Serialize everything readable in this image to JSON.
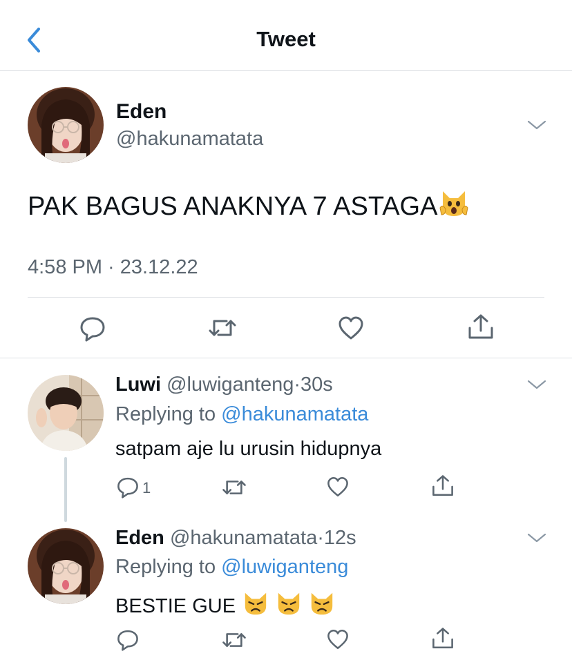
{
  "header": {
    "title": "Tweet",
    "back_icon": "chevron-left-icon"
  },
  "main_tweet": {
    "name": "Eden",
    "handle": "@hakunamatata",
    "text": "PAK BAGUS ANAKNYA 7 ASTAGA",
    "text_emoji": "weary-cat-face",
    "timestamp": "4:58 PM · 23.12.22",
    "actions": [
      "reply-icon",
      "retweet-icon",
      "like-icon",
      "share-icon"
    ]
  },
  "replies": [
    {
      "name": "Luwi",
      "handle": "@luwiganteng",
      "sep": "·",
      "time": "30s",
      "replying_prefix": "Replying to",
      "replying_to": "@hakunamatata",
      "text": "satpam aje lu urusin hidupnya",
      "reply_count": "1"
    },
    {
      "name": "Eden",
      "handle": "@hakunamatata",
      "sep": "·",
      "time": "12s",
      "replying_prefix": "Replying to",
      "replying_to": "@luwiganteng",
      "text": "BESTIE GUE",
      "text_emoji": [
        "pouting-cat-face",
        "pouting-cat-face",
        "pouting-cat-face"
      ]
    }
  ],
  "colors": {
    "accent": "#3a8bd9",
    "secondary_text": "#5b6670",
    "divider": "#dcdfe3",
    "emoji": "#f5bd3d"
  }
}
